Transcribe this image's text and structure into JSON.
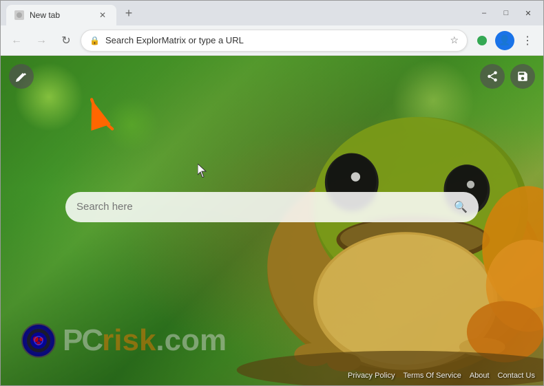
{
  "window": {
    "title": "New tab",
    "tab_label": "New tab",
    "controls": {
      "minimize": "–",
      "maximize": "□",
      "close": "✕"
    }
  },
  "toolbar": {
    "omnibox_placeholder": "Search ExplorMatrix or type a URL",
    "nav": {
      "back": "←",
      "forward": "→",
      "reload": "↻"
    }
  },
  "page": {
    "search_placeholder": "Search here",
    "share_icon": "share",
    "save_icon": "bookmark",
    "edit_icon": "edit"
  },
  "footer": {
    "privacy_policy": "Privacy Policy",
    "terms_of_service": "Terms Of Service",
    "about": "About",
    "contact_us": "Contact Us"
  },
  "branding": {
    "pcrisk_text": "PC",
    "pcrisk_domain": "risk.com"
  }
}
